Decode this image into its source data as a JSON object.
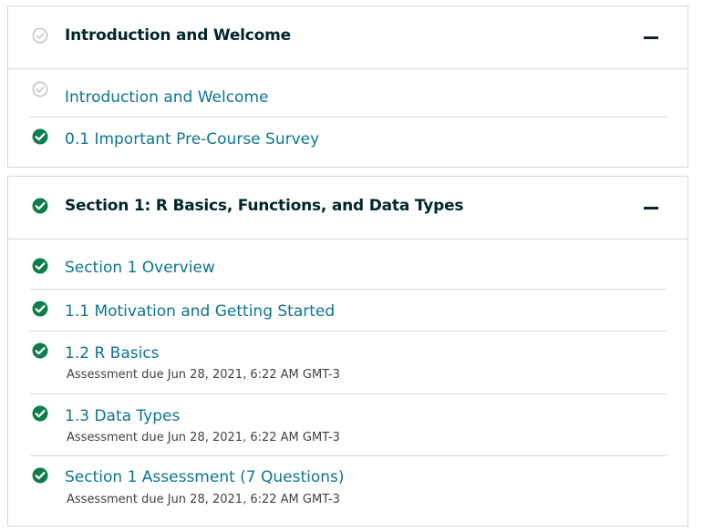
{
  "colors": {
    "complete_check": "#0d7d4d",
    "incomplete_check": "#c4c4c4",
    "link": "#0d7493",
    "heading": "#00262b"
  },
  "sections": [
    {
      "title": "Introduction and Welcome",
      "status_icon": "incomplete-check-icon",
      "toggle_icon": "minus-icon",
      "units": [
        {
          "title": "Introduction and Welcome",
          "status_icon": "incomplete-check-icon"
        },
        {
          "title": "0.1 Important Pre-Course Survey",
          "status_icon": "complete-check-icon"
        }
      ]
    },
    {
      "title": "Section 1: R Basics, Functions, and Data Types",
      "status_icon": "complete-check-icon",
      "toggle_icon": "minus-icon",
      "units": [
        {
          "title": "Section 1 Overview",
          "status_icon": "complete-check-icon"
        },
        {
          "title": "1.1 Motivation and Getting Started",
          "status_icon": "complete-check-icon"
        },
        {
          "title": "1.2 R Basics",
          "status_icon": "complete-check-icon",
          "due": "Assessment due Jun 28, 2021, 6:22 AM GMT-3"
        },
        {
          "title": "1.3 Data Types",
          "status_icon": "complete-check-icon",
          "due": "Assessment due Jun 28, 2021, 6:22 AM GMT-3"
        },
        {
          "title": "Section 1 Assessment (7 Questions)",
          "status_icon": "complete-check-icon",
          "due": "Assessment due Jun 28, 2021, 6:22 AM GMT-3"
        }
      ]
    }
  ]
}
